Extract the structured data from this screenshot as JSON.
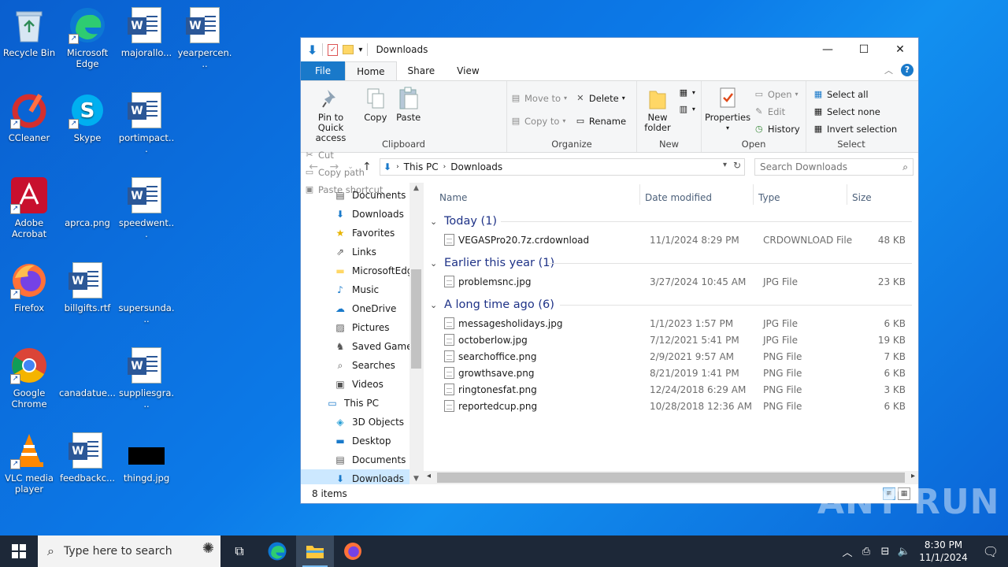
{
  "desktop": {
    "icons": [
      {
        "label": "Recycle Bin"
      },
      {
        "label": "Microsoft Edge"
      },
      {
        "label": "majorallo..."
      },
      {
        "label": "yearpercen..."
      },
      {
        "label": "CCleaner"
      },
      {
        "label": "Skype"
      },
      {
        "label": "portimpact..."
      },
      {
        "label": "Adobe Acrobat"
      },
      {
        "label": "aprca.png"
      },
      {
        "label": "speedwent..."
      },
      {
        "label": "Firefox"
      },
      {
        "label": "billgifts.rtf"
      },
      {
        "label": "supersunda..."
      },
      {
        "label": "Google Chrome"
      },
      {
        "label": "canadatue..."
      },
      {
        "label": "suppliesgra..."
      },
      {
        "label": "VLC media player"
      },
      {
        "label": "feedbackc..."
      },
      {
        "label": "thingd.jpg"
      }
    ]
  },
  "window": {
    "title": "Downloads",
    "tabs": {
      "file": "File",
      "home": "Home",
      "share": "Share",
      "view": "View"
    },
    "ribbon": {
      "clipboard": {
        "group": "Clipboard",
        "pin": "Pin to Quick access",
        "copy": "Copy",
        "paste": "Paste",
        "cut": "Cut",
        "copy_path": "Copy path",
        "paste_shortcut": "Paste shortcut"
      },
      "organize": {
        "group": "Organize",
        "move_to": "Move to",
        "copy_to": "Copy to",
        "delete": "Delete",
        "rename": "Rename"
      },
      "new": {
        "group": "New",
        "new_folder": "New folder"
      },
      "open": {
        "group": "Open",
        "properties": "Properties",
        "open": "Open",
        "edit": "Edit",
        "history": "History"
      },
      "select": {
        "group": "Select",
        "select_all": "Select all",
        "select_none": "Select none",
        "invert": "Invert selection"
      }
    },
    "address": {
      "crumbs": [
        "This PC",
        "Downloads"
      ]
    },
    "search": {
      "placeholder": "Search Downloads"
    },
    "nav": [
      {
        "label": "Documents",
        "icon": "documents-icon"
      },
      {
        "label": "Downloads",
        "icon": "downloads-icon"
      },
      {
        "label": "Favorites",
        "icon": "star-icon"
      },
      {
        "label": "Links",
        "icon": "links-icon"
      },
      {
        "label": "MicrosoftEdge",
        "icon": "folder-icon"
      },
      {
        "label": "Music",
        "icon": "music-icon"
      },
      {
        "label": "OneDrive",
        "icon": "onedrive-icon"
      },
      {
        "label": "Pictures",
        "icon": "pictures-icon"
      },
      {
        "label": "Saved Games",
        "icon": "saved-games-icon"
      },
      {
        "label": "Searches",
        "icon": "search-icon"
      },
      {
        "label": "Videos",
        "icon": "videos-icon"
      },
      {
        "label": "This PC",
        "icon": "pc-icon"
      },
      {
        "label": "3D Objects",
        "icon": "3d-objects-icon"
      },
      {
        "label": "Desktop",
        "icon": "desktop-icon"
      },
      {
        "label": "Documents",
        "icon": "documents-icon"
      },
      {
        "label": "Downloads",
        "icon": "downloads-icon"
      }
    ],
    "columns": {
      "name": "Name",
      "date": "Date modified",
      "type": "Type",
      "size": "Size"
    },
    "groups": [
      {
        "label": "Today (1)",
        "files": [
          {
            "name": "VEGASPro20.7z.crdownload",
            "date": "11/1/2024 8:29 PM",
            "type": "CRDOWNLOAD File",
            "size": "48 KB"
          }
        ]
      },
      {
        "label": "Earlier this year (1)",
        "files": [
          {
            "name": "problemsnc.jpg",
            "date": "3/27/2024 10:45 AM",
            "type": "JPG File",
            "size": "23 KB"
          }
        ]
      },
      {
        "label": "A long time ago (6)",
        "files": [
          {
            "name": "messagesholidays.jpg",
            "date": "1/1/2023 1:57 PM",
            "type": "JPG File",
            "size": "6 KB"
          },
          {
            "name": "octoberlow.jpg",
            "date": "7/12/2021 5:41 PM",
            "type": "JPG File",
            "size": "19 KB"
          },
          {
            "name": "searchoffice.png",
            "date": "2/9/2021 9:57 AM",
            "type": "PNG File",
            "size": "7 KB"
          },
          {
            "name": "growthsave.png",
            "date": "8/21/2019 1:41 PM",
            "type": "PNG File",
            "size": "6 KB"
          },
          {
            "name": "ringtonesfat.png",
            "date": "12/24/2018 6:29 AM",
            "type": "PNG File",
            "size": "3 KB"
          },
          {
            "name": "reportedcup.png",
            "date": "10/28/2018 12:36 AM",
            "type": "PNG File",
            "size": "6 KB"
          }
        ]
      }
    ],
    "status": "8 items"
  },
  "taskbar": {
    "search_placeholder": "Type here to search",
    "time": "8:30 PM",
    "date": "11/1/2024"
  },
  "watermark": "ANY RUN",
  "colors": {
    "accent": "#1979ca",
    "selection": "#cce8ff",
    "taskbar": "#1d2838"
  }
}
